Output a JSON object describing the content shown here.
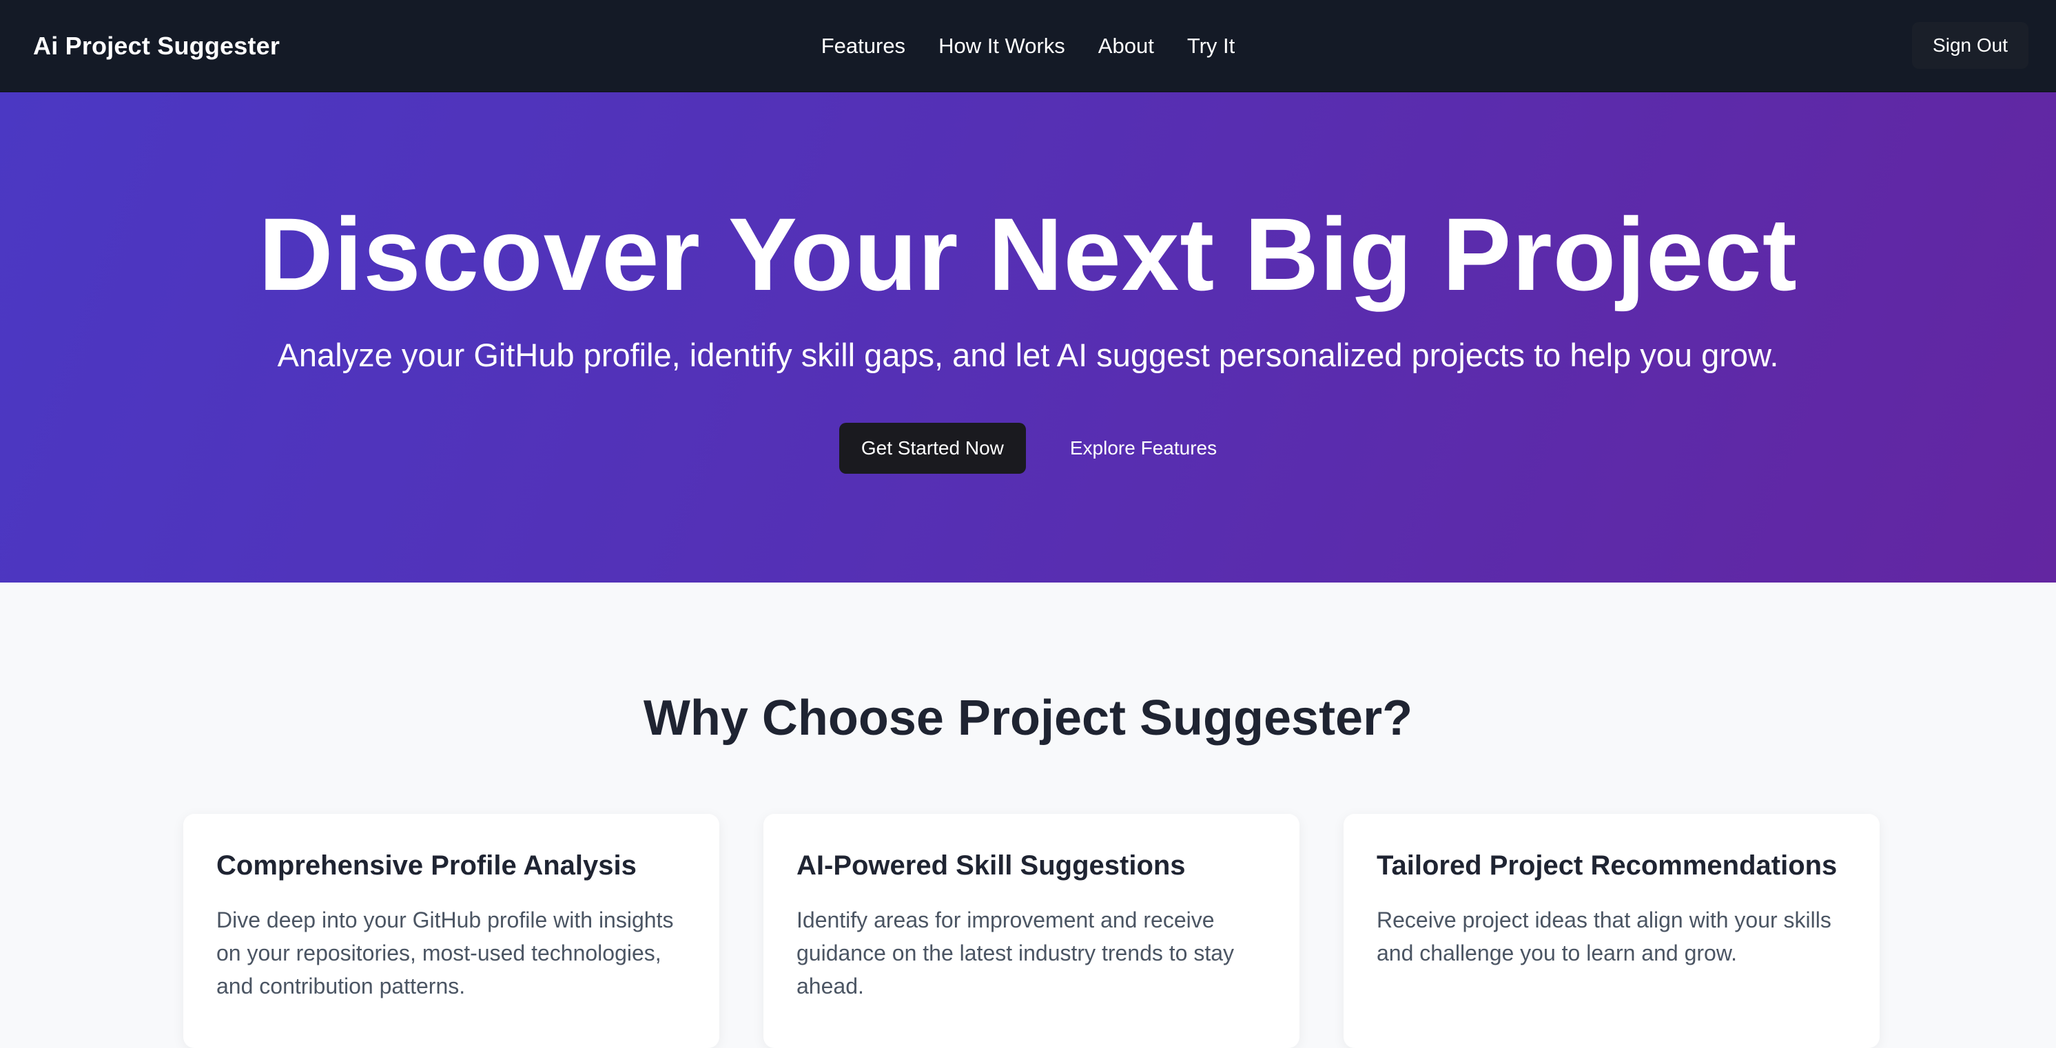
{
  "navbar": {
    "brand": "Ai Project Suggester",
    "links": [
      "Features",
      "How It Works",
      "About",
      "Try It"
    ],
    "sign_out_label": "Sign Out"
  },
  "hero": {
    "title": "Discover Your Next Big Project",
    "subtitle": "Analyze your GitHub profile, identify skill gaps, and let AI suggest personalized projects to help you grow.",
    "primary_button": "Get Started Now",
    "secondary_button": "Explore Features"
  },
  "features": {
    "title": "Why Choose Project Suggester?",
    "cards": [
      {
        "title": "Comprehensive Profile Analysis",
        "text": "Dive deep into your GitHub profile with insights on your repositories, most-used technologies, and contribution patterns."
      },
      {
        "title": "AI-Powered Skill Suggestions",
        "text": "Identify areas for improvement and receive guidance on the latest industry trends to stay ahead."
      },
      {
        "title": "Tailored Project Recommendations",
        "text": "Receive project ideas that align with your skills and challenge you to learn and grow."
      }
    ]
  },
  "colors": {
    "navbar_bg": "#141a26",
    "hero_gradient_start": "#4b38c3",
    "hero_gradient_end": "#6326a1",
    "primary_button_bg": "#1a1a1f",
    "page_bg": "#f8f9fb",
    "heading_text": "#1f2432",
    "body_text": "#4b5563"
  }
}
